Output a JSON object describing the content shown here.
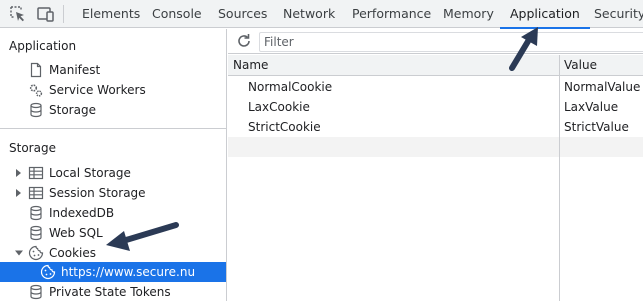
{
  "tabs": [
    "Elements",
    "Console",
    "Sources",
    "Network",
    "Performance",
    "Memory",
    "Application",
    "Security"
  ],
  "sidebar": {
    "application_title": "Application",
    "application_items": [
      "Manifest",
      "Service Workers",
      "Storage"
    ],
    "storage_title": "Storage",
    "storage_items": [
      "Local Storage",
      "Session Storage",
      "IndexedDB",
      "Web SQL",
      "Cookies"
    ],
    "cookie_origin": "https://www.secure.nu",
    "last_item": "Private State Tokens"
  },
  "filter": {
    "placeholder": "Filter"
  },
  "table": {
    "columns": [
      "Name",
      "Value"
    ],
    "rows": [
      {
        "name": "NormalCookie",
        "value": "NormalValue"
      },
      {
        "name": "LaxCookie",
        "value": "LaxValue"
      },
      {
        "name": "StrictCookie",
        "value": "StrictValue"
      }
    ]
  },
  "colors": {
    "accent": "#1a73e8",
    "arrow": "#2b3a55"
  }
}
